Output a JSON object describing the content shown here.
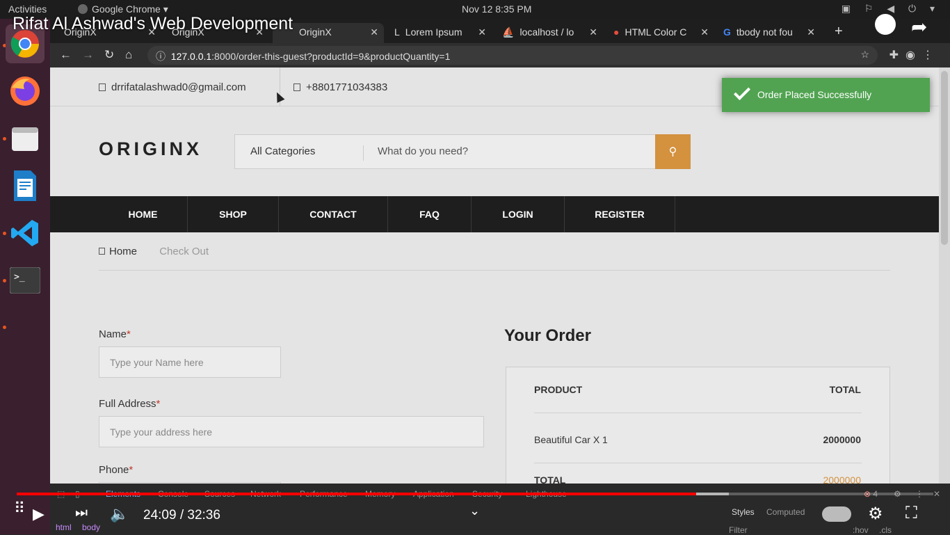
{
  "system": {
    "activities": "Activities",
    "app_name": "Google Chrome",
    "clock": "Nov 12  8:35 PM"
  },
  "video": {
    "title": "Rifat Al Ashwad's Web Development",
    "time": "24:09 / 32:36",
    "progress": 0.741,
    "buffered": 0.777
  },
  "tabs": [
    {
      "label": "OriginX"
    },
    {
      "label": "OriginX"
    },
    {
      "label": "OriginX"
    },
    {
      "label": "Lorem Ipsum"
    },
    {
      "label": "localhost / lo"
    },
    {
      "label": "HTML Color C"
    },
    {
      "label": "tbody not fou"
    }
  ],
  "browser": {
    "url_host": "127.0.0.1",
    "url_rest": ":8000/order-this-guest?productId=9&productQuantity=1"
  },
  "site": {
    "email": "drrifatalashwad0@gmail.com",
    "phone": "+8801771034383",
    "logo": "ORIGINX",
    "search_category": "All Categories",
    "search_placeholder": "What do you need?",
    "nav": [
      "HOME",
      "SHOP",
      "CONTACT",
      "FAQ",
      "LOGIN",
      "REGISTER"
    ],
    "breadcrumb_home": "Home",
    "breadcrumb_current": "Check Out",
    "form": {
      "name_label": "Name",
      "name_placeholder": "Type your Name here",
      "address_label": "Full Address",
      "address_placeholder": "Type your address here",
      "phone_label": "Phone",
      "required_mark": "*"
    },
    "order": {
      "heading": "Your Order",
      "col_product": "PRODUCT",
      "col_total": "TOTAL",
      "item_name": "Beautiful Car X 1",
      "item_price": "2000000",
      "total_label": "TOTAL",
      "total_value": "2000000",
      "accent_color": "#d4913e"
    },
    "toast": "Order Placed Successfully"
  },
  "devtools": {
    "tabs": [
      "Elements",
      "Console",
      "Sources",
      "Network",
      "Performance",
      "Memory",
      "Application",
      "Security",
      "Lighthouse"
    ],
    "error_count": "4",
    "side_tabs": [
      "Styles",
      "Computed"
    ],
    "crumbs": [
      "html",
      "body"
    ],
    "filter": "Filter",
    "hov": ":hov",
    "cls": ".cls"
  }
}
